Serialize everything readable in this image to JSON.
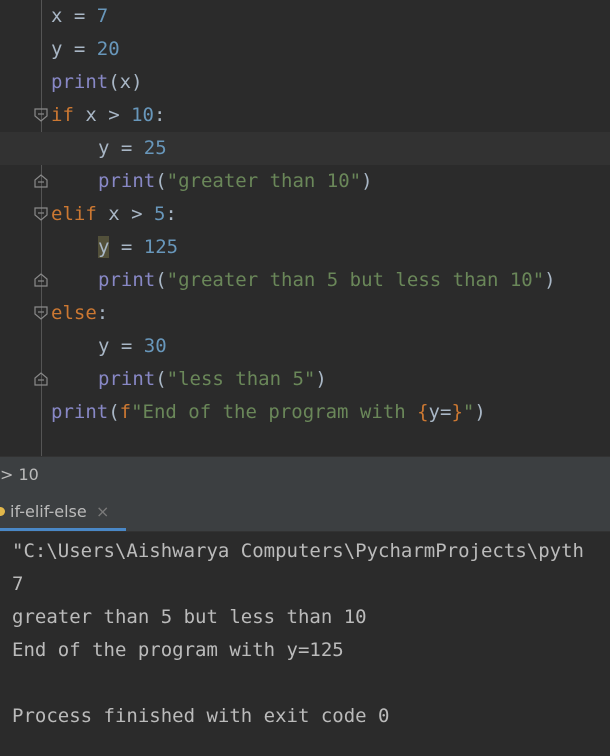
{
  "editor": {
    "lines": {
      "l0": {
        "var": "x",
        "op": " = ",
        "num": "7"
      },
      "l1": {
        "var": "y",
        "op": " = ",
        "num": "20"
      },
      "l2": {
        "fn": "print",
        "open": "(",
        "arg": "x",
        "close": ")"
      },
      "l3": {
        "kw": "if",
        "sp": " x > ",
        "num": "10",
        "colon": ":"
      },
      "l4": {
        "var": "y",
        "op": " = ",
        "num": "25"
      },
      "l5": {
        "fn": "print",
        "open": "(",
        "str": "\"greater than 10\"",
        "close": ")"
      },
      "l6": {
        "kw": "elif",
        "sp": " x > ",
        "num": "5",
        "colon": ":"
      },
      "l7": {
        "var": "y",
        "op": " = ",
        "num": "125"
      },
      "l8": {
        "fn": "print",
        "open": "(",
        "str": "\"greater than 5 but less than 10\"",
        "close": ")"
      },
      "l9": {
        "kw": "else",
        "colon": ":"
      },
      "l10": {
        "var": "y",
        "op": " = ",
        "num": "30"
      },
      "l11": {
        "fn": "print",
        "open": "(",
        "str": "\"less than 5\"",
        "close": ")"
      },
      "l12": {
        "fn": "print",
        "open": "(",
        "fprefix": "f",
        "str1": "\"End of the program with ",
        "lb": "{",
        "expr": "y=",
        "rb": "}",
        "str2": "\"",
        "close": ")"
      }
    }
  },
  "breadcrumb": {
    "text": "> 10"
  },
  "run_panel": {
    "tab_label": "if-elif-else",
    "close_glyph": "×"
  },
  "console": {
    "lines": [
      "\"C:\\Users\\Aishwarya Computers\\PycharmProjects\\pyth",
      "7",
      "greater than 5 but less than 10",
      "End of the program with y=125",
      "",
      "Process finished with exit code 0"
    ]
  },
  "colors": {
    "keyword": "#cc7832",
    "number": "#6897bb",
    "builtin": "#8888c6",
    "string": "#6a8759",
    "default": "#a9b7c6"
  }
}
